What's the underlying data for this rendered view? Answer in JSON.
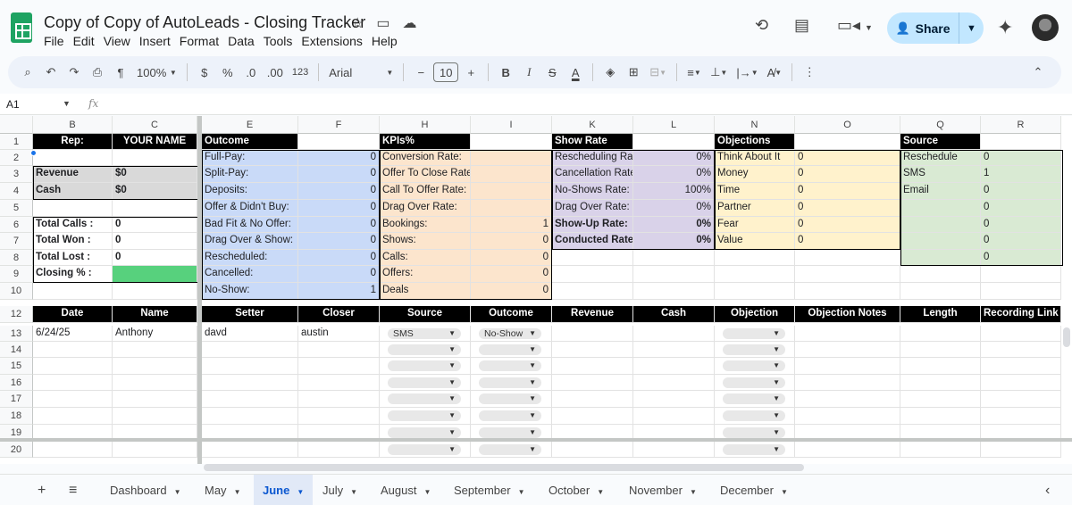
{
  "doc": {
    "title": "Copy of Copy of AutoLeads  - Closing Tracker"
  },
  "menu": [
    "File",
    "Edit",
    "View",
    "Insert",
    "Format",
    "Data",
    "Tools",
    "Extensions",
    "Help"
  ],
  "share": {
    "label": "Share"
  },
  "toolbar": {
    "zoom": "100%",
    "currency": "$",
    "percent": "%",
    "dec_less": ".0",
    "dec_more": ".00",
    "number_format": "123",
    "font": "Arial",
    "font_size": "10",
    "bold": "B",
    "italic": "I",
    "strike": "S",
    "text_color": "A"
  },
  "formula_bar": {
    "cell_ref": "A1",
    "fx": "fx"
  },
  "columns": [
    "B",
    "C",
    "E",
    "F",
    "H",
    "I",
    "K",
    "L",
    "N",
    "O",
    "Q",
    "R"
  ],
  "rows": [
    "1",
    "2",
    "3",
    "4",
    "5",
    "6",
    "7",
    "8",
    "9",
    "10",
    "12",
    "13",
    "14",
    "15",
    "16",
    "17",
    "18",
    "19",
    "20"
  ],
  "summary": {
    "rep_label": "Rep:",
    "rep_value": "YOUR NAME",
    "revenue_label": "Revenue",
    "revenue_value": "$0",
    "cash_label": "Cash",
    "cash_value": "$0",
    "calls_label": "Total Calls :",
    "calls_value": "0",
    "won_label": "Total Won :",
    "won_value": "0",
    "lost_label": "Total Lost :",
    "lost_value": "0",
    "closing_label": "Closing % :"
  },
  "outcome": {
    "header": "Outcome",
    "rows": [
      {
        "label": "Full-Pay:",
        "value": "0"
      },
      {
        "label": "Split-Pay:",
        "value": "0"
      },
      {
        "label": "Deposits:",
        "value": "0"
      },
      {
        "label": "Offer & Didn't Buy:",
        "value": "0"
      },
      {
        "label": "Bad Fit & No Offer:",
        "value": "0"
      },
      {
        "label": "Drag Over & Show:",
        "value": "0"
      },
      {
        "label": "Rescheduled:",
        "value": "0"
      },
      {
        "label": "Cancelled:",
        "value": "0"
      },
      {
        "label": "No-Show:",
        "value": "1"
      }
    ]
  },
  "kpis": {
    "header": "KPIs%",
    "rows": [
      {
        "label": "Conversion Rate:",
        "value": ""
      },
      {
        "label": "Offer To Close Rate:",
        "value": ""
      },
      {
        "label": "Call To Offer Rate:",
        "value": ""
      },
      {
        "label": "Drag Over Rate:",
        "value": ""
      },
      {
        "label": "Bookings:",
        "value": "1"
      },
      {
        "label": "Shows:",
        "value": "0"
      },
      {
        "label": "Calls:",
        "value": "0"
      },
      {
        "label": "Offers:",
        "value": "0"
      },
      {
        "label": "Deals",
        "value": "0"
      }
    ]
  },
  "show_rate": {
    "header": "Show Rate",
    "rows": [
      {
        "label": "Rescheduling Rate",
        "value": "0%"
      },
      {
        "label": "Cancellation Rate:",
        "value": "0%"
      },
      {
        "label": "No-Shows Rate:",
        "value": "100%"
      },
      {
        "label": "Drag Over Rate:",
        "value": "0%"
      },
      {
        "label": "Show-Up Rate:",
        "value": "0%"
      },
      {
        "label": "Conducted Rate:",
        "value": "0%"
      }
    ]
  },
  "objections": {
    "header": "Objections",
    "rows": [
      {
        "label": "Think About It",
        "value": "0"
      },
      {
        "label": "Money",
        "value": "0"
      },
      {
        "label": "Time",
        "value": "0"
      },
      {
        "label": "Partner",
        "value": "0"
      },
      {
        "label": "Fear",
        "value": "0"
      },
      {
        "label": "Value",
        "value": "0"
      }
    ]
  },
  "source": {
    "header": "Source",
    "rows": [
      {
        "label": "Reschedule",
        "value": "0"
      },
      {
        "label": "SMS",
        "value": "1"
      },
      {
        "label": "Email",
        "value": "0"
      },
      {
        "label": "",
        "value": "0"
      },
      {
        "label": "",
        "value": "0"
      },
      {
        "label": "",
        "value": "0"
      },
      {
        "label": "",
        "value": "0"
      }
    ]
  },
  "table_headers": [
    "Date",
    "Name",
    "Setter",
    "Closer",
    "Source",
    "Outcome",
    "Revenue",
    "Cash",
    "Objection",
    "Objection Notes",
    "Length",
    "Recording Link"
  ],
  "entry": {
    "date": "6/24/25",
    "name": "Anthony",
    "setter": "davd",
    "closer": "austin",
    "source": "SMS",
    "outcome": "No-Show"
  },
  "tabs": [
    "Dashboard",
    "May",
    "June",
    "July",
    "August",
    "September",
    "October",
    "November",
    "December"
  ],
  "active_tab": "June",
  "colors": {
    "outcome_bg": "#c9daf8",
    "kpi_bg": "#fce5cd",
    "show_rate_bg": "#d9d2e9",
    "objections_bg": "#fff2cc",
    "source_bg": "#d9ead3",
    "closing_bg": "#57d17d",
    "summary_bg": "#d9d9d9"
  }
}
